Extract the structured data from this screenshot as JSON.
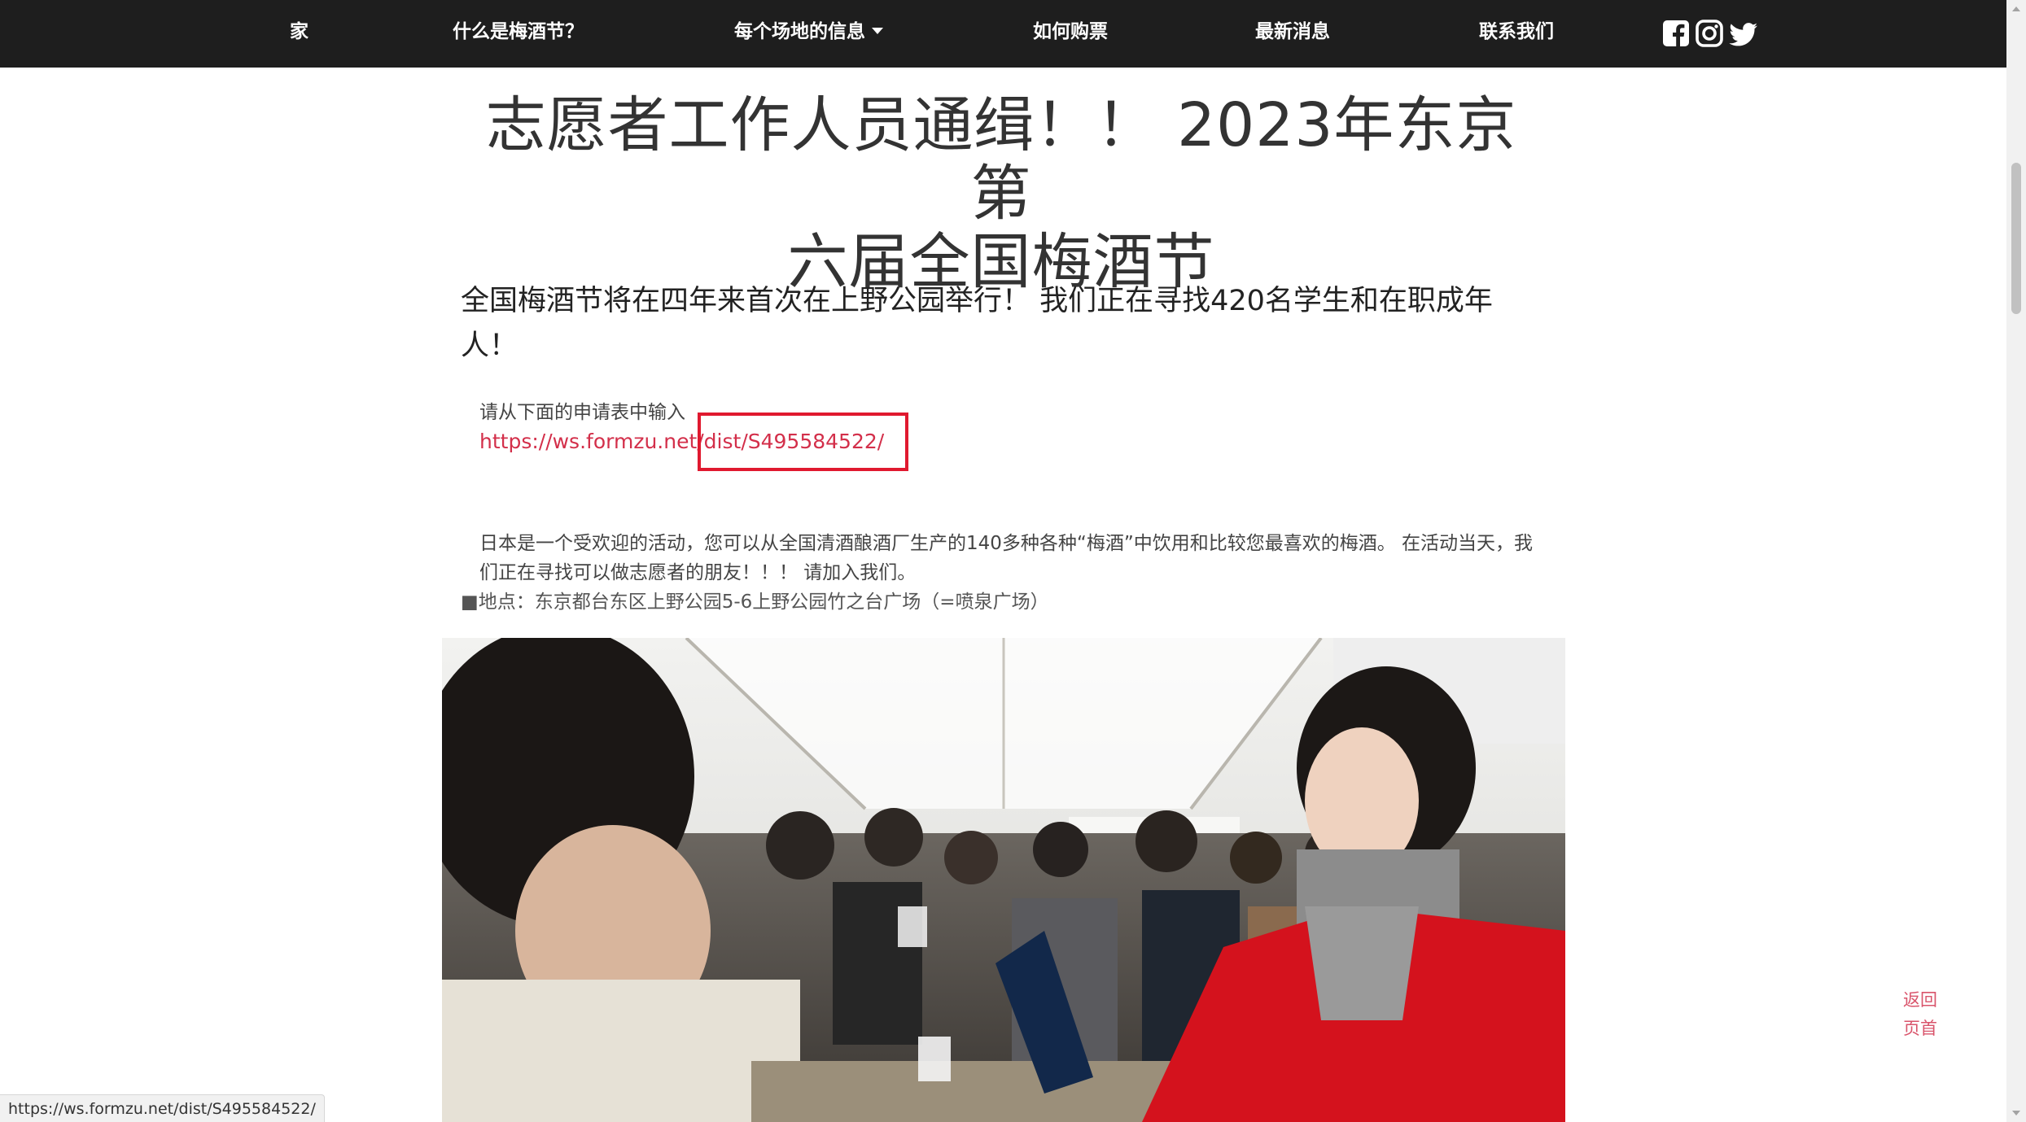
{
  "nav": {
    "home": "家",
    "what_is": "什么是梅酒节？",
    "venues": "每个场地的信息",
    "tickets": "如何购票",
    "news": "最新消息",
    "contact": "联系我们"
  },
  "social": {
    "facebook_icon": "facebook-icon",
    "instagram_icon": "instagram-icon",
    "twitter_icon": "twitter-icon"
  },
  "article": {
    "title_line1": "志愿者工作人员通缉！！ 2023年东京第",
    "title_line2": "六届全国梅酒节",
    "subtitle": "全国梅酒节将在四年来首次在上野公园举行！ 我们正在寻找420名学生和在职成年人！",
    "apply_text": "请从下面的申请表中输入",
    "apply_link": "https://ws.formzu.net/dist/S495584522/",
    "paragraph": "日本是一个受欢迎的活动，您可以从全国清酒酿酒厂生产的140多种各种“梅酒”中饮用和比较您最喜欢的梅酒。 在活动当天，我们正在寻找可以做志愿者的朋友！！！ 请加入我们。",
    "location": "■地点：东京都台东区上野公园5-6上野公园竹之台广场（=喷泉广场）"
  },
  "back_to_top": "返回页首",
  "status_bar": "https://ws.formzu.net/dist/S495584522/",
  "colors": {
    "nav_bg": "#1e1e1e",
    "link": "#d32f4a",
    "highlight": "#e0192f",
    "back_to_top": "#d9546b"
  }
}
